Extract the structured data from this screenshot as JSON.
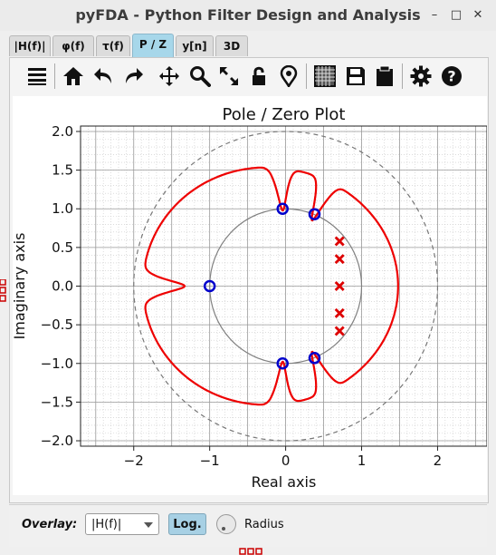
{
  "window": {
    "title": "pyFDA - Python Filter Design and Analysis",
    "minimize_glyph": "–",
    "maximize_glyph": "□",
    "close_glyph": "✕"
  },
  "tabs": [
    {
      "label": "|H(f)|",
      "active": false
    },
    {
      "label": "φ(f)",
      "active": false
    },
    {
      "label": "τ(f)",
      "active": false
    },
    {
      "label": "P / Z",
      "active": true
    },
    {
      "label": "y[n]",
      "active": false
    },
    {
      "label": "3D",
      "active": false
    }
  ],
  "toolbar": {
    "icons": [
      "menu-icon",
      "home-icon",
      "undo-icon",
      "redo-icon",
      "pan-icon",
      "zoom-icon",
      "full-view-icon",
      "lock-icon",
      "marker-icon",
      "grid-icon",
      "save-icon",
      "clipboard-icon",
      "settings-icon",
      "help-icon"
    ]
  },
  "chart_data": {
    "type": "scatter",
    "title": "Pole / Zero Plot",
    "xlabel": "Real axis",
    "ylabel": "Imaginary axis",
    "xlim": [
      -2.7,
      2.65
    ],
    "ylim": [
      -2.07,
      2.07
    ],
    "xticks": [
      -2,
      -1,
      0,
      1,
      2
    ],
    "xtick_labels": [
      "−2",
      "−1",
      "0",
      "1",
      "2"
    ],
    "yticks": [
      2.0,
      1.5,
      1.0,
      0.5,
      0.0,
      -0.5,
      -1.0,
      -1.5,
      -2.0
    ],
    "ytick_labels": [
      "2.0",
      "1.5",
      "1.0",
      "0.5",
      "0.0",
      "−0.5",
      "−1.0",
      "−1.5",
      "−2.0"
    ],
    "grid": true,
    "unit_circle_radius": 1.0,
    "outer_circle_radius": 2.0,
    "zeros": [
      {
        "re": -1.0,
        "im": 0.0
      },
      {
        "re": -0.04,
        "im": 1.0
      },
      {
        "re": -0.04,
        "im": -1.0
      },
      {
        "re": 0.38,
        "im": 0.93
      },
      {
        "re": 0.38,
        "im": -0.93
      }
    ],
    "poles": [
      {
        "re": 0.71,
        "im": 0.58
      },
      {
        "re": 0.71,
        "im": 0.35
      },
      {
        "re": 0.71,
        "im": 0.0
      },
      {
        "re": 0.71,
        "im": -0.35
      },
      {
        "re": 0.71,
        "im": -0.58
      }
    ],
    "colors": {
      "zeros": "#0000cc",
      "poles": "#dd0000",
      "overlay": "#ee0000",
      "unit_circle": "#808080"
    }
  },
  "overlay": {
    "label": "Overlay:",
    "selected": "|H(f)|",
    "log_button": "Log.",
    "radius_label": "Radius"
  }
}
